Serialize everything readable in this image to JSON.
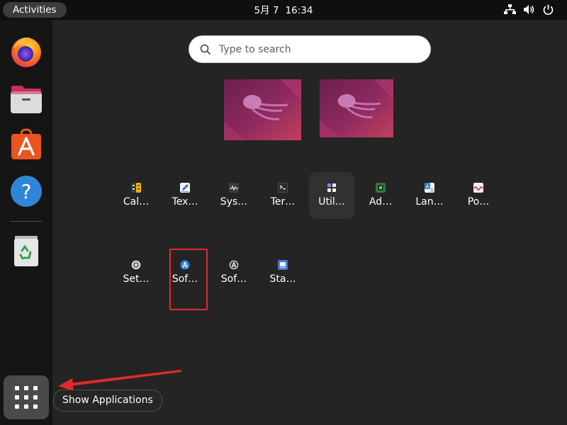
{
  "topbar": {
    "activities_label": "Activities",
    "date": "5月 7",
    "time": "16:34",
    "tray_icons": [
      "network-icon",
      "volume-icon",
      "power-icon"
    ]
  },
  "dock": {
    "apps": [
      {
        "name": "firefox",
        "icon": "firefox-icon"
      },
      {
        "name": "files",
        "icon": "files-icon"
      },
      {
        "name": "app-center",
        "icon": "app-center-icon"
      },
      {
        "name": "help",
        "icon": "help-icon"
      },
      {
        "name": "trash",
        "icon": "trash-icon"
      }
    ],
    "show_apps_icon": "grid-icon"
  },
  "search": {
    "placeholder": "Type to search"
  },
  "workspaces": [
    {
      "label": "workspace-1"
    },
    {
      "label": "workspace-2"
    }
  ],
  "app_grid": {
    "row1": [
      {
        "label": "Cal…",
        "icon": "calculator-icon"
      },
      {
        "label": "Tex…",
        "icon": "text-editor-icon"
      },
      {
        "label": "Sys…",
        "icon": "system-monitor-icon"
      },
      {
        "label": "Ter…",
        "icon": "terminal-icon"
      },
      {
        "label": "Util…",
        "icon": "utilities-folder-icon"
      },
      {
        "label": "Ad…",
        "icon": "additional-drivers-icon"
      },
      {
        "label": "Lan…",
        "icon": "language-support-icon"
      },
      {
        "label": "Po…",
        "icon": "power-statistics-icon"
      }
    ],
    "row2": [
      {
        "label": "Set…",
        "icon": "settings-icon"
      },
      {
        "label": "Sof…",
        "icon": "software-updater-icon"
      },
      {
        "label": "Sof…",
        "icon": "software-properties-icon"
      },
      {
        "label": "Sta…",
        "icon": "startup-applications-icon"
      }
    ]
  },
  "tooltip": {
    "text": "Show Applications"
  },
  "colors": {
    "accent": "#e95420",
    "annotation_red": "#e32a2a",
    "dock_bg": "#151515",
    "overview_bg": "#242424"
  }
}
